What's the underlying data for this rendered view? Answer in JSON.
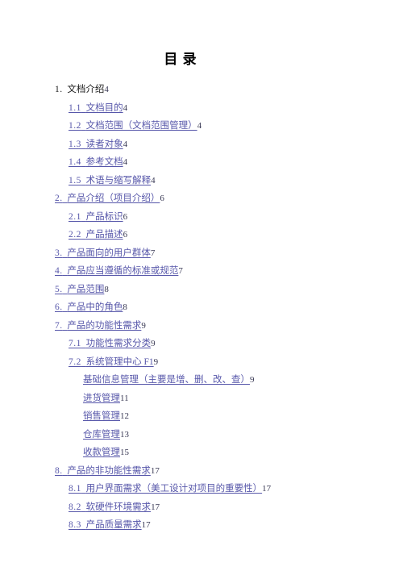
{
  "document": {
    "title": "目 录",
    "link_color": "#5757aa",
    "text_color": "#1a1a1a",
    "background": "#ffffff"
  },
  "toc": {
    "entries": [
      {
        "prefix": "1.",
        "text": "文档介绍",
        "page": "4",
        "level": 1,
        "link": false
      },
      {
        "prefix": "1.1",
        "text": "文档目的",
        "page": "4",
        "level": 2,
        "link": true
      },
      {
        "prefix": "1.2",
        "text": "文档范围（文档范围管理）",
        "page": "4",
        "level": 2,
        "link": true
      },
      {
        "prefix": "1.3",
        "text": "读者对象",
        "page": "4",
        "level": 2,
        "link": true
      },
      {
        "prefix": "1.4",
        "text": "参考文档",
        "page": "4",
        "level": 2,
        "link": true
      },
      {
        "prefix": "1.5",
        "text": "术语与缩写解释",
        "page": "4",
        "level": 2,
        "link": true
      },
      {
        "prefix": "2.",
        "text": "产品介绍（项目介绍）",
        "page": "6",
        "level": 1,
        "link": true
      },
      {
        "prefix": "2.1",
        "text": "产品标识",
        "page": "6",
        "level": 2,
        "link": true
      },
      {
        "prefix": "2.2",
        "text": "产品描述",
        "page": "6",
        "level": 2,
        "link": true
      },
      {
        "prefix": "3.",
        "text": "产品面向的用户群体",
        "page": "7",
        "level": 1,
        "link": true
      },
      {
        "prefix": "4.",
        "text": "产品应当遵循的标准或规范",
        "page": "7",
        "level": 1,
        "link": true
      },
      {
        "prefix": "5.",
        "text": "产品范围",
        "page": "8",
        "level": 1,
        "link": true
      },
      {
        "prefix": "6.",
        "text": "产品中的角色",
        "page": "8",
        "level": 1,
        "link": true
      },
      {
        "prefix": "7.",
        "text": "产品的功能性需求",
        "page": "9",
        "level": 1,
        "link": true
      },
      {
        "prefix": "7.1",
        "text": "功能性需求分类",
        "page": "9",
        "level": 2,
        "link": true
      },
      {
        "prefix": "7.2",
        "text": "系统管理中心 F1",
        "page": "9",
        "level": 2,
        "link": true
      },
      {
        "prefix": "",
        "text": "基础信息管理（主要是增、删、改、查）",
        "page": "9",
        "level": 3,
        "link": true
      },
      {
        "prefix": "",
        "text": "进货管理",
        "page": "11",
        "level": 3,
        "link": true
      },
      {
        "prefix": "",
        "text": "销售管理",
        "page": "12",
        "level": 3,
        "link": true
      },
      {
        "prefix": "",
        "text": "仓库管理",
        "page": "13",
        "level": 3,
        "link": true
      },
      {
        "prefix": "",
        "text": "收款管理",
        "page": "15",
        "level": 3,
        "link": true
      },
      {
        "prefix": "8.",
        "text": "产品的非功能性需求",
        "page": "17",
        "level": 1,
        "link": true
      },
      {
        "prefix": "8.1",
        "text": "用户界面需求（美工设计对项目的重要性）",
        "page": "17",
        "level": 2,
        "link": true
      },
      {
        "prefix": "8.2",
        "text": "软硬件环境需求",
        "page": "17",
        "level": 2,
        "link": true
      },
      {
        "prefix": "8.3",
        "text": "产品质量需求",
        "page": "17",
        "level": 2,
        "link": true
      }
    ]
  }
}
